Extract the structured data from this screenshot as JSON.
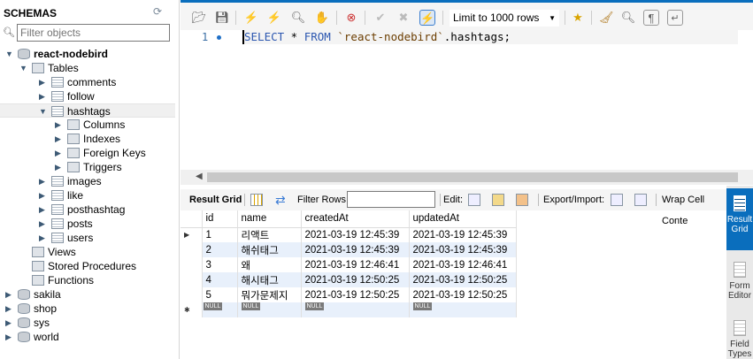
{
  "sidebar": {
    "title": "SCHEMAS",
    "filter_placeholder": "Filter objects",
    "tree": [
      {
        "label": "react-nodebird",
        "level": 0,
        "icon": "database-icon",
        "expanded": true,
        "bold": true
      },
      {
        "label": "Tables",
        "level": 1,
        "icon": "folder-icon",
        "expanded": true
      },
      {
        "label": "comments",
        "level": 2,
        "icon": "table-icon",
        "expanded": false
      },
      {
        "label": "follow",
        "level": 2,
        "icon": "table-icon",
        "expanded": false
      },
      {
        "label": "hashtags",
        "level": 2,
        "icon": "table-icon",
        "expanded": true,
        "selected": true
      },
      {
        "label": "Columns",
        "level": 3,
        "icon": "folder-icon",
        "expanded": false
      },
      {
        "label": "Indexes",
        "level": 3,
        "icon": "folder-icon",
        "expanded": false
      },
      {
        "label": "Foreign Keys",
        "level": 3,
        "icon": "folder-icon",
        "expanded": false
      },
      {
        "label": "Triggers",
        "level": 3,
        "icon": "folder-icon",
        "expanded": false
      },
      {
        "label": "images",
        "level": 2,
        "icon": "table-icon",
        "expanded": false
      },
      {
        "label": "like",
        "level": 2,
        "icon": "table-icon",
        "expanded": false
      },
      {
        "label": "posthashtag",
        "level": 2,
        "icon": "table-icon",
        "expanded": false
      },
      {
        "label": "posts",
        "level": 2,
        "icon": "table-icon",
        "expanded": false
      },
      {
        "label": "users",
        "level": 2,
        "icon": "table-icon",
        "expanded": false
      },
      {
        "label": "Views",
        "level": 1,
        "icon": "folder-icon",
        "leaf": true
      },
      {
        "label": "Stored Procedures",
        "level": 1,
        "icon": "folder-icon",
        "leaf": true
      },
      {
        "label": "Functions",
        "level": 1,
        "icon": "folder-icon",
        "leaf": true
      },
      {
        "label": "sakila",
        "level": 0,
        "icon": "database-icon",
        "expanded": false
      },
      {
        "label": "shop",
        "level": 0,
        "icon": "database-icon",
        "expanded": false
      },
      {
        "label": "sys",
        "level": 0,
        "icon": "database-icon",
        "expanded": false
      },
      {
        "label": "world",
        "level": 0,
        "icon": "database-icon",
        "expanded": false
      }
    ]
  },
  "toolbar": {
    "limit": "Limit to 1000 rows"
  },
  "editor": {
    "line_number": "1",
    "kw1": "SELECT",
    "rest1": " * ",
    "kw2": "FROM",
    "str": " `react-nodebird`",
    "tail": ".hashtags;"
  },
  "results": {
    "toolbar": {
      "result_grid": "Result Grid",
      "filter_rows": "Filter Rows:",
      "edit": "Edit:",
      "export_import": "Export/Import:",
      "wrap": "Wrap Cell Conte"
    },
    "columns": [
      "id",
      "name",
      "createdAt",
      "updatedAt"
    ],
    "rows": [
      [
        "1",
        "리액트",
        "2021-03-19 12:45:39",
        "2021-03-19 12:45:39"
      ],
      [
        "2",
        "해쉬태그",
        "2021-03-19 12:45:39",
        "2021-03-19 12:45:39"
      ],
      [
        "3",
        "왜",
        "2021-03-19 12:46:41",
        "2021-03-19 12:46:41"
      ],
      [
        "4",
        "해시태그",
        "2021-03-19 12:50:25",
        "2021-03-19 12:50:25"
      ],
      [
        "5",
        "뭐가문제지",
        "2021-03-19 12:50:25",
        "2021-03-19 12:50:25"
      ]
    ],
    "null_label": "NULL"
  },
  "side_panel": [
    {
      "label": "Result Grid",
      "active": true
    },
    {
      "label": "Form Editor"
    },
    {
      "label": "Field Types"
    }
  ],
  "colors": {
    "accent": "#0a6ebd"
  }
}
